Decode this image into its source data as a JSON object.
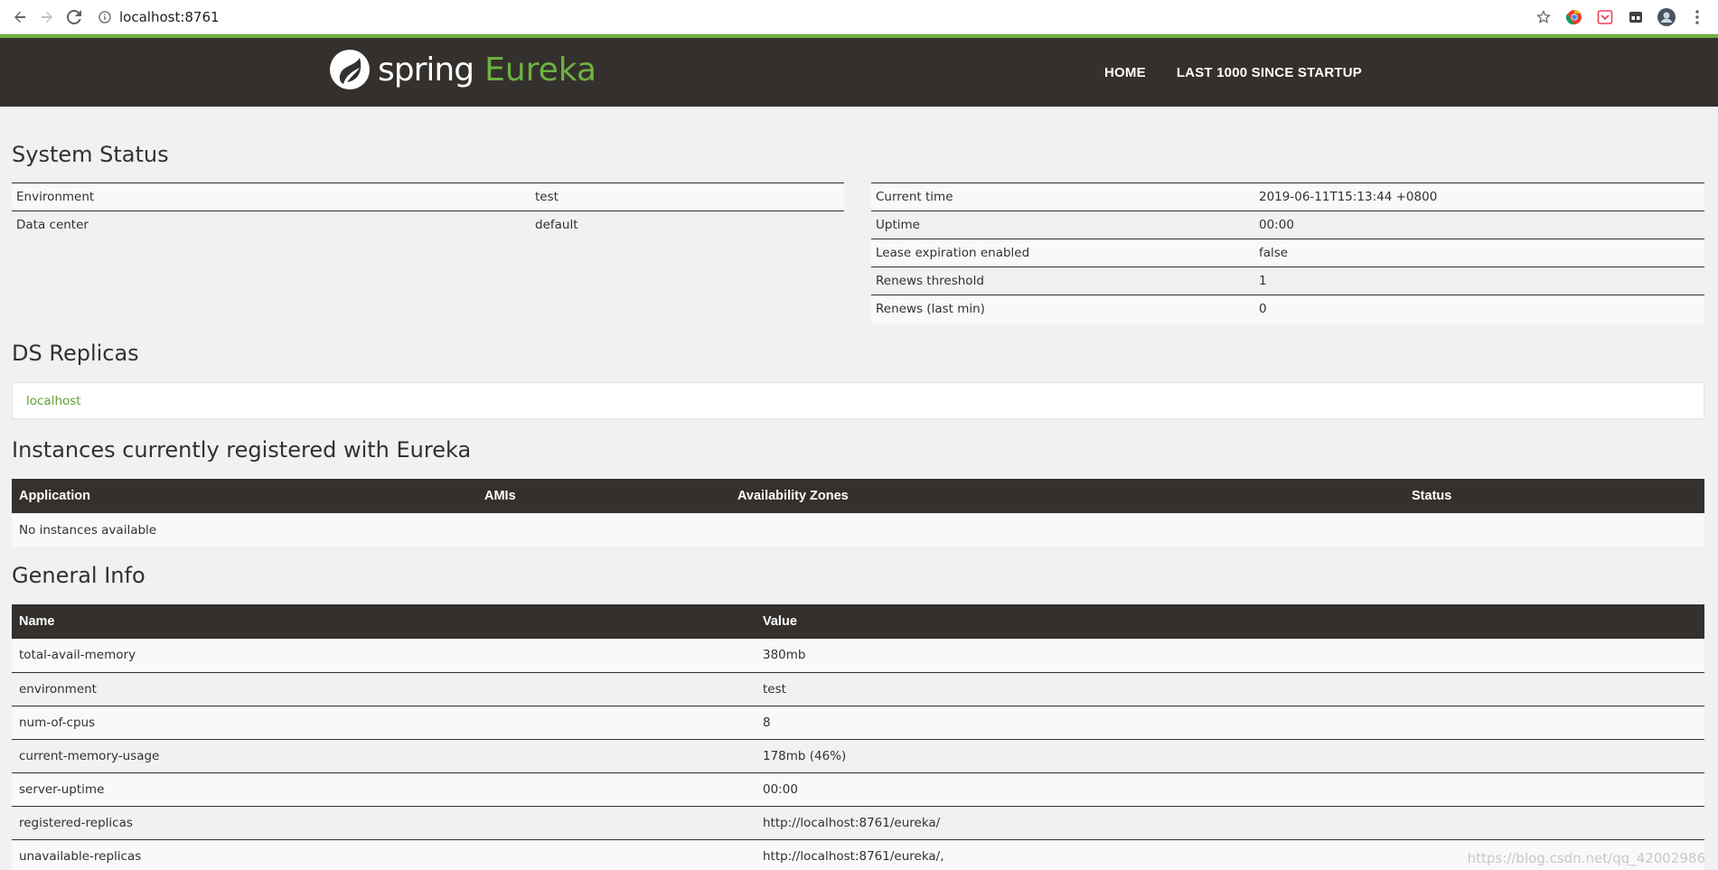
{
  "browser": {
    "url": "localhost:8761",
    "extensions": [
      "star-icon",
      "chrome-extension-icon",
      "pocket-icon",
      "extension-icon",
      "profile-avatar",
      "menu-icon"
    ]
  },
  "header": {
    "brand_spring": "spring",
    "brand_eureka": "Eureka",
    "nav": {
      "home": "HOME",
      "last1000": "LAST 1000 SINCE STARTUP"
    },
    "colors": {
      "bar": "#34302d",
      "accent": "#6db33f"
    }
  },
  "system_status": {
    "title": "System Status",
    "left": [
      {
        "label": "Environment",
        "value": "test"
      },
      {
        "label": "Data center",
        "value": "default"
      }
    ],
    "right": [
      {
        "label": "Current time",
        "value": "2019-06-11T15:13:44 +0800"
      },
      {
        "label": "Uptime",
        "value": "00:00"
      },
      {
        "label": "Lease expiration enabled",
        "value": "false"
      },
      {
        "label": "Renews threshold",
        "value": "1"
      },
      {
        "label": "Renews (last min)",
        "value": "0"
      }
    ]
  },
  "ds_replicas": {
    "title": "DS Replicas",
    "items": [
      "localhost"
    ]
  },
  "instances": {
    "title": "Instances currently registered with Eureka",
    "columns": [
      "Application",
      "AMIs",
      "Availability Zones",
      "Status"
    ],
    "empty_text": "No instances available"
  },
  "general_info": {
    "title": "General Info",
    "columns": [
      "Name",
      "Value"
    ],
    "rows": [
      {
        "name": "total-avail-memory",
        "value": "380mb"
      },
      {
        "name": "environment",
        "value": "test"
      },
      {
        "name": "num-of-cpus",
        "value": "8"
      },
      {
        "name": "current-memory-usage",
        "value": "178mb (46%)"
      },
      {
        "name": "server-uptime",
        "value": "00:00"
      },
      {
        "name": "registered-replicas",
        "value": "http://localhost:8761/eureka/"
      },
      {
        "name": "unavailable-replicas",
        "value": "http://localhost:8761/eureka/,"
      }
    ]
  },
  "watermark": "https://blog.csdn.net/qq_42002986"
}
